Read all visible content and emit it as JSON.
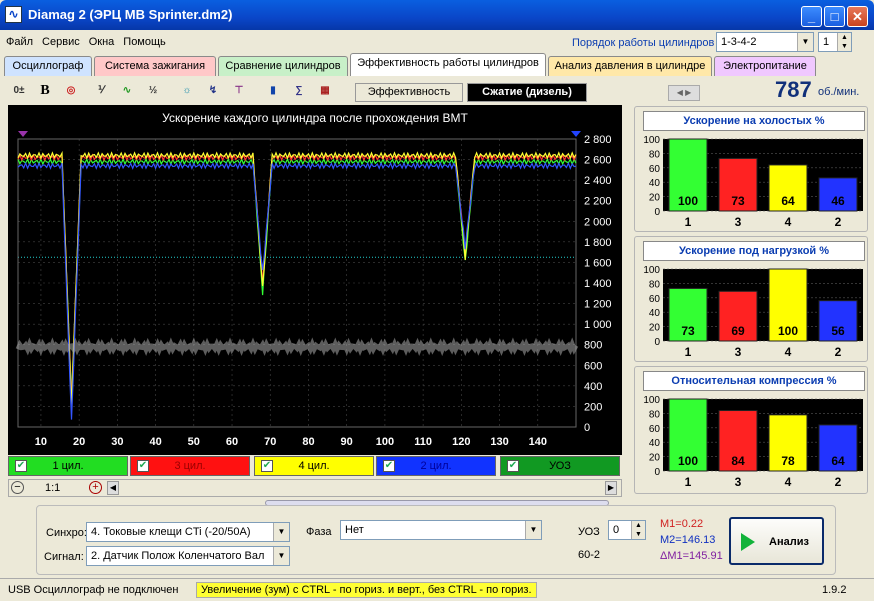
{
  "window": {
    "title": "Diamag 2 (ЭРЦ MB Sprinter.dm2)",
    "app_icon": "waveform-icon"
  },
  "menu": [
    "Файл",
    "Сервис",
    "Окна",
    "Помощь"
  ],
  "firing_order": {
    "label": "Порядок работы цилиндров",
    "value": "1-3-4-2",
    "spin_value": "1"
  },
  "tabs": [
    {
      "label": "Осциллограф",
      "color": "#cfe3ff"
    },
    {
      "label": "Система зажигания",
      "color": "#ffc8c8"
    },
    {
      "label": "Сравнение цилиндров",
      "color": "#c8f0c8"
    },
    {
      "label": "Эффективность работы цилиндров",
      "color": "#ffffff"
    },
    {
      "label": "Анализ давления в цилиндре",
      "color": "#ffe8a8"
    },
    {
      "label": "Электропитание",
      "color": "#f0c8ff"
    }
  ],
  "subtabs": {
    "efficiency": "Эффективность",
    "compression": "Сжатие (дизель)"
  },
  "rpm": {
    "value": "787",
    "unit": "об./мин."
  },
  "plot": {
    "title": "Ускорение каждого цилиндра после прохождения ВМТ"
  },
  "chart_data": {
    "type": "line",
    "title": "Ускорение каждого цилиндра после прохождения ВМТ",
    "xlim": [
      4,
      150
    ],
    "ylim": [
      0,
      2800
    ],
    "x_ticks": [
      10,
      20,
      30,
      40,
      50,
      60,
      70,
      80,
      90,
      100,
      110,
      120,
      130,
      140
    ],
    "y_ticks": [
      "0",
      "200",
      "400",
      "600",
      "800",
      "1 000",
      "1 200",
      "1 400",
      "1 600",
      "1 800",
      "2 000",
      "2 200",
      "2 400",
      "2 600",
      "2 800"
    ],
    "series": [
      {
        "name": "1 цил.",
        "color": "#33ff33",
        "baseline": 2580,
        "dips": [
          [
            18,
            300
          ],
          [
            68,
            1300
          ],
          [
            121,
            1600
          ]
        ]
      },
      {
        "name": "3 цил.",
        "color": "#ff3333",
        "baseline": 2620,
        "dips": [
          [
            18,
            250
          ],
          [
            68,
            1400
          ],
          [
            121,
            1700
          ]
        ]
      },
      {
        "name": "4 цил.",
        "color": "#ffff33",
        "baseline": 2640,
        "dips": [
          [
            18,
            200
          ],
          [
            68,
            1350
          ],
          [
            121,
            1650
          ]
        ]
      },
      {
        "name": "2 цил.",
        "color": "#3355ff",
        "baseline": 2540,
        "dips": [
          [
            18,
            50
          ],
          [
            68,
            1500
          ],
          [
            121,
            1750
          ]
        ]
      },
      {
        "name": "УОЗ",
        "color": "#aaaaaa",
        "baseline": 780,
        "dips": []
      }
    ],
    "reference_level": 1650
  },
  "series_buttons": [
    {
      "label": "1 цил.",
      "bg": "#22dd22",
      "fg": "#000000"
    },
    {
      "label": "3 цил.",
      "bg": "#ff1111",
      "fg": "#990000"
    },
    {
      "label": "4 цил.",
      "bg": "#ffff00",
      "fg": "#000000"
    },
    {
      "label": "2 цил.",
      "bg": "#1133ff",
      "fg": "#000099"
    },
    {
      "label": "УОЗ",
      "bg": "#119922",
      "fg": "#000000"
    }
  ],
  "zoom": {
    "value": "1:1"
  },
  "panels": [
    {
      "title": "Ускорение на холостых %",
      "bars": [
        {
          "label": "1",
          "value": 100,
          "color": "#33ff33"
        },
        {
          "label": "3",
          "value": 73,
          "color": "#ff2222"
        },
        {
          "label": "4",
          "value": 64,
          "color": "#ffff00"
        },
        {
          "label": "2",
          "value": 46,
          "color": "#2233ff"
        }
      ]
    },
    {
      "title": "Ускорение под нагрузкой %",
      "bars": [
        {
          "label": "1",
          "value": 73,
          "color": "#33ff33"
        },
        {
          "label": "3",
          "value": 69,
          "color": "#ff2222"
        },
        {
          "label": "4",
          "value": 100,
          "color": "#ffff00"
        },
        {
          "label": "2",
          "value": 56,
          "color": "#2233ff"
        }
      ]
    },
    {
      "title": "Относительная компрессия %",
      "bars": [
        {
          "label": "1",
          "value": 100,
          "color": "#33ff33"
        },
        {
          "label": "3",
          "value": 84,
          "color": "#ff2222"
        },
        {
          "label": "4",
          "value": 78,
          "color": "#ffff00"
        },
        {
          "label": "2",
          "value": 64,
          "color": "#2233ff"
        }
      ]
    }
  ],
  "bottom": {
    "sync_label": "Синхро:",
    "sync_value": "4.  Токовые клещи CTi (-20/50A)",
    "signal_label": "Сигнал:",
    "signal_value": "2.  Датчик Полож Коленчатого Вал",
    "phase_label": "Фаза",
    "phase_value": "Нет",
    "uoz_label": "УОЗ",
    "uoz_value": "0",
    "uoz_sub": "60-2",
    "m1": "M1=0.22",
    "m2": "M2=146.13",
    "dm": "ΔM1=145.91",
    "analysis": "Анализ"
  },
  "status": {
    "left": "USB Осциллограф не подключен",
    "hint": "Увеличение (зум) с CTRL - по гориз. и верт., без CTRL - по гориз.",
    "version": "1.9.2"
  }
}
